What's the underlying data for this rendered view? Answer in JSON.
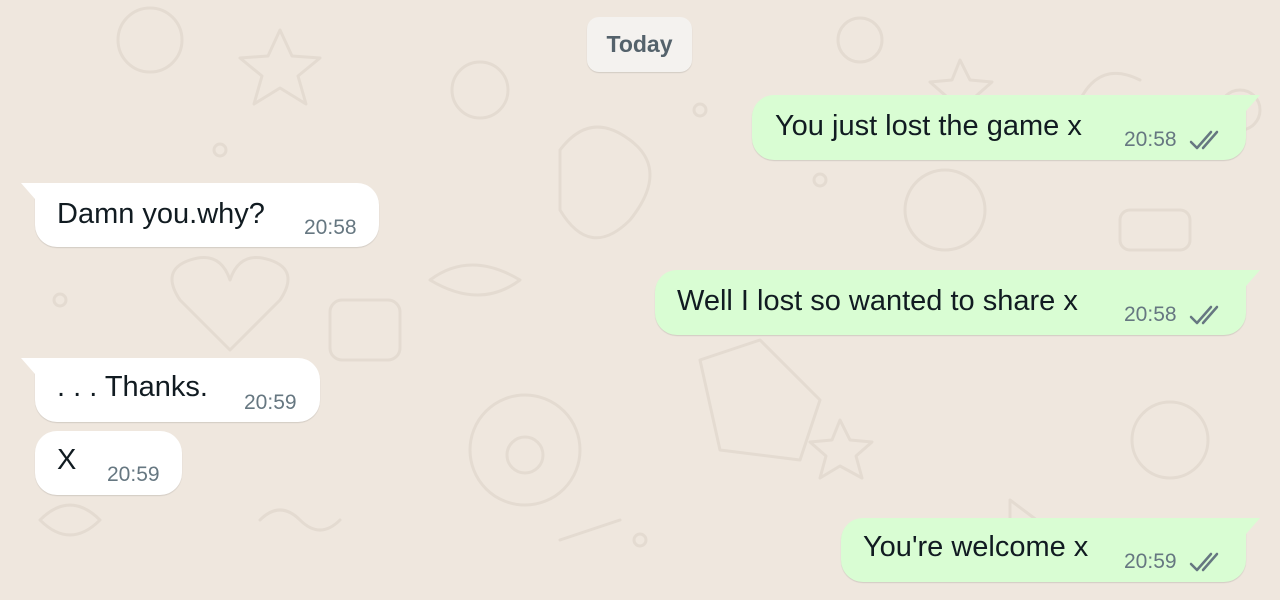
{
  "chat": {
    "date_label": "Today",
    "messages": [
      {
        "direction": "out",
        "text": "You just lost the game x",
        "time": "20:58",
        "status": "read-ticks-icon"
      },
      {
        "direction": "in",
        "text": "Damn you.why?",
        "time": "20:58"
      },
      {
        "direction": "out",
        "text": "Well I lost so wanted to share x",
        "time": "20:58",
        "status": "read-ticks-icon"
      },
      {
        "direction": "in",
        "text": ". . . Thanks.",
        "time": "20:59"
      },
      {
        "direction": "in",
        "text": "X",
        "time": "20:59"
      },
      {
        "direction": "out",
        "text": "You're welcome x",
        "time": "20:59",
        "status": "read-ticks-icon"
      }
    ]
  },
  "colors": {
    "background": "#efe7de",
    "incoming_bubble": "#ffffff",
    "outgoing_bubble": "#d9fdd3",
    "timestamp": "#667781",
    "ticks": "#667781"
  }
}
